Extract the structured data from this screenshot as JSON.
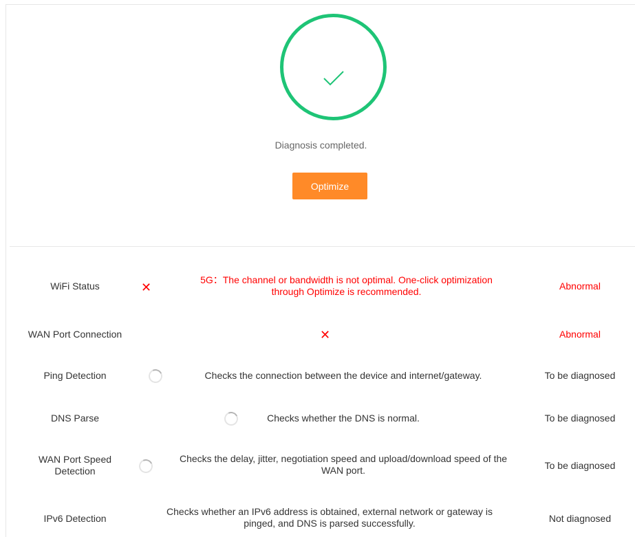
{
  "status": {
    "icon": "checkmark-icon",
    "color": "#1ec476",
    "message": "Diagnosis completed.",
    "optimize_label": "Optimize",
    "optimize_color": "#ff8a28"
  },
  "error_color": "#ff0000",
  "items": [
    {
      "name": "WiFi Status",
      "icon": "error-x-icon",
      "description": "5G：The channel or bandwidth is not optimal. One-click optimization through Optimize is recommended.",
      "result": "Abnormal"
    },
    {
      "name": "WAN Port Connection",
      "icon": "error-x-icon",
      "description": "",
      "result": "Abnormal"
    },
    {
      "name": "Ping Detection",
      "icon": "loading-spinner-icon",
      "description": "Checks the connection between the device and internet/gateway.",
      "result": "To be diagnosed"
    },
    {
      "name": "DNS Parse",
      "icon": "loading-spinner-icon",
      "description": "Checks whether the DNS is normal.",
      "result": "To be diagnosed"
    },
    {
      "name": "WAN Port Speed Detection",
      "icon": "loading-spinner-icon",
      "description": "Checks the delay, jitter, negotiation speed and upload/download speed of the WAN port.",
      "result": "To be diagnosed"
    },
    {
      "name": "IPv6 Detection",
      "icon": "loading-spinner-icon",
      "description": "Checks whether an IPv6 address is obtained, external network or gateway is pinged, and DNS is parsed successfully.",
      "result": "Not diagnosed"
    }
  ]
}
